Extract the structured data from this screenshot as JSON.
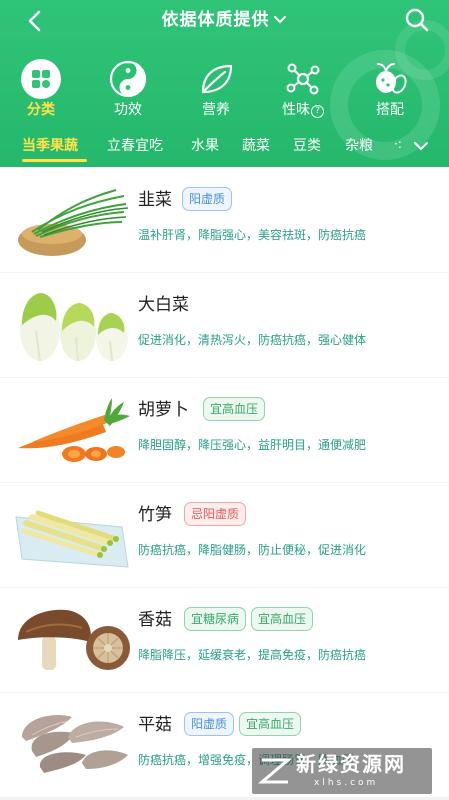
{
  "header": {
    "title": "依据体质提供",
    "back_icon": "back-arrow-icon",
    "search_icon": "search-icon",
    "bg_color": "#2fc477",
    "active_color": "#ffe14a"
  },
  "categories": [
    {
      "label": "分类",
      "icon": "grid-icon",
      "active": true
    },
    {
      "label": "功效",
      "icon": "yin-yang-icon",
      "active": false
    },
    {
      "label": "营养",
      "icon": "leaf-icon",
      "active": false
    },
    {
      "label": "性味",
      "icon": "molecule-icon",
      "active": false,
      "help": "?"
    },
    {
      "label": "搭配",
      "icon": "vegetables-icon",
      "active": false
    }
  ],
  "tabs": [
    {
      "label": "当季果蔬",
      "active": true
    },
    {
      "label": "立春宜吃",
      "active": false
    },
    {
      "label": "水果",
      "active": false
    },
    {
      "label": "蔬菜",
      "active": false
    },
    {
      "label": "豆类",
      "active": false
    },
    {
      "label": "杂粮",
      "active": false
    }
  ],
  "tabs_more": "expand-chevron-icon",
  "tabs_overflow": "·:",
  "foods": [
    {
      "name": "韭菜",
      "tags": [
        {
          "text": "阳虚质",
          "color": "blue"
        }
      ],
      "effects": "温补肝肾，降脂强心，美容祛斑，防癌抗癌",
      "image": "chives"
    },
    {
      "name": "大白菜",
      "tags": [],
      "effects": "促进消化，清热泻火，防癌抗癌，强心健体",
      "image": "napa-cabbage"
    },
    {
      "name": "胡萝卜",
      "tags": [
        {
          "text": "宜高血压",
          "color": "green"
        }
      ],
      "effects": "降胆固醇，降压强心，益肝明目，通便减肥",
      "image": "carrot"
    },
    {
      "name": "竹笋",
      "tags": [
        {
          "text": "忌阳虚质",
          "color": "red"
        }
      ],
      "effects": "防癌抗癌，降脂健肠，防止便秘，促进消化",
      "image": "bamboo-shoots"
    },
    {
      "name": "香菇",
      "tags": [
        {
          "text": "宜糖尿病",
          "color": "green"
        },
        {
          "text": "宜高血压",
          "color": "green"
        }
      ],
      "effects": "降脂降压，延缓衰老，提高免疫，防癌抗癌",
      "image": "shiitake"
    },
    {
      "name": "平菇",
      "tags": [
        {
          "text": "阳虚质",
          "color": "blue"
        },
        {
          "text": "宜高血压",
          "color": "green"
        }
      ],
      "effects": "防癌抗癌，增强免疫，调理肠胃，降血压",
      "image": "oyster-mushroom"
    }
  ],
  "watermark": {
    "text": "新绿资源网",
    "url": "xlhs.com"
  }
}
